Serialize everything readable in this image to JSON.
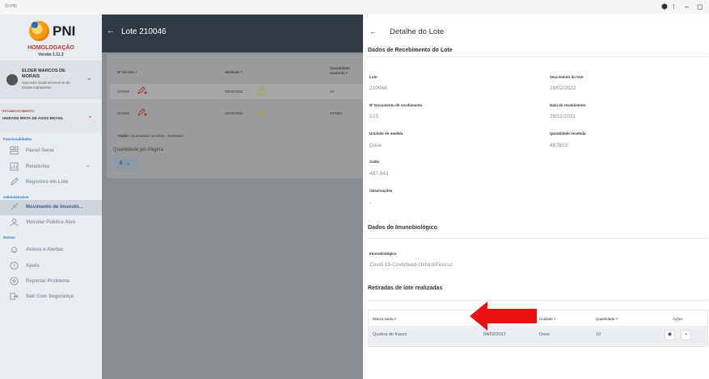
{
  "window": {
    "app_name": "SI-PNI",
    "controls": [
      "⬢",
      "⁝",
      "–",
      "◻"
    ]
  },
  "sidebar": {
    "logo_text": "PNI",
    "env_title": "HOMOLOGAÇÃO",
    "env_version": "Versão 1.11.3",
    "user": {
      "name": "ELDER MARCOS DE MORAIS",
      "role": "Operador Estabelecimento de Saúde-Campanha"
    },
    "establishment": {
      "label": "ESTABELECIMENTO",
      "value": "UNIDADE MISTA DE ASSIS BRASIL"
    },
    "sections": {
      "features": "Funcionalidades",
      "admin": "Administrativo",
      "others": "Outros"
    },
    "items": [
      {
        "label": "Painel Geral",
        "icon": "dashboard-icon"
      },
      {
        "label": "Relatórios",
        "icon": "reports-icon"
      },
      {
        "label": "Registros em Lote",
        "icon": "pen-icon"
      },
      {
        "label": "Movimento de Imunobi...",
        "icon": "syringe-icon"
      },
      {
        "label": "Vincular Público Alvo",
        "icon": "person-icon"
      },
      {
        "label": "Avisos e Alertas",
        "icon": "bell-icon"
      },
      {
        "label": "Ajuda",
        "icon": "help-icon"
      },
      {
        "label": "Reportar Problema",
        "icon": "report-icon"
      },
      {
        "label": "Sair Com Segurança",
        "icon": "logout-icon"
      }
    ]
  },
  "header": {
    "back": "←",
    "title": "Lote 210046"
  },
  "list": {
    "columns": [
      "Nº do lote",
      "Validade",
      "Quantidade recebida"
    ],
    "rows": [
      {
        "lote": "210046",
        "validade": "28/02/2022",
        "quantidade": "10"
      },
      {
        "lote": "210046",
        "validade": "28/02/2022",
        "quantidade": "487853"
      }
    ],
    "saldo_note_bold": "*Saldo:",
    "saldo_note": "Quantidade recebida - Retiradas",
    "per_page_label": "Quantidade por Página",
    "per_page_value": "5"
  },
  "detail": {
    "back": "←",
    "title": "Detalhe do Lote",
    "receipt_heading": "Dados de Recebimento do Lote",
    "fields": {
      "lote_label": "Lote",
      "lote_value": "210046",
      "vencimento_label": "Vencimento do lote",
      "vencimento_value": "28/02/2022",
      "documento_label": "Nº Documento de recebimento",
      "documento_value": "123",
      "data_label": "Data do recebimento",
      "data_value": "29/11/2021",
      "unidade_label": "Unidade de medida",
      "unidade_value": "Dose",
      "quantidade_label": "Quantidade recebida",
      "quantidade_value": "487853",
      "saldo_label": "Saldo",
      "saldo_value": "487.843",
      "obs_label": "Observações",
      "obs_value": "-"
    },
    "immuno_heading": "Dados do Imunobiológico",
    "immuno_label": "Imunobiológico",
    "immuno_value": "Covid-19-Covishield-Oxford/Fiocruz",
    "withdrawals_heading": "Retiradas de lote realizadas",
    "withdrawals": {
      "columns": [
        "Motivo saída",
        "Unidade",
        "Quantidade",
        "Ações"
      ],
      "rows": [
        {
          "motivo": "Quebra do frasco",
          "data": "04/03/2022",
          "unidade": "Dose",
          "quantidade": "10"
        }
      ]
    }
  },
  "colors": {
    "header_bg": "#303a45",
    "accent_red": "#e8110f",
    "link_blue": "#2a7bbf"
  }
}
